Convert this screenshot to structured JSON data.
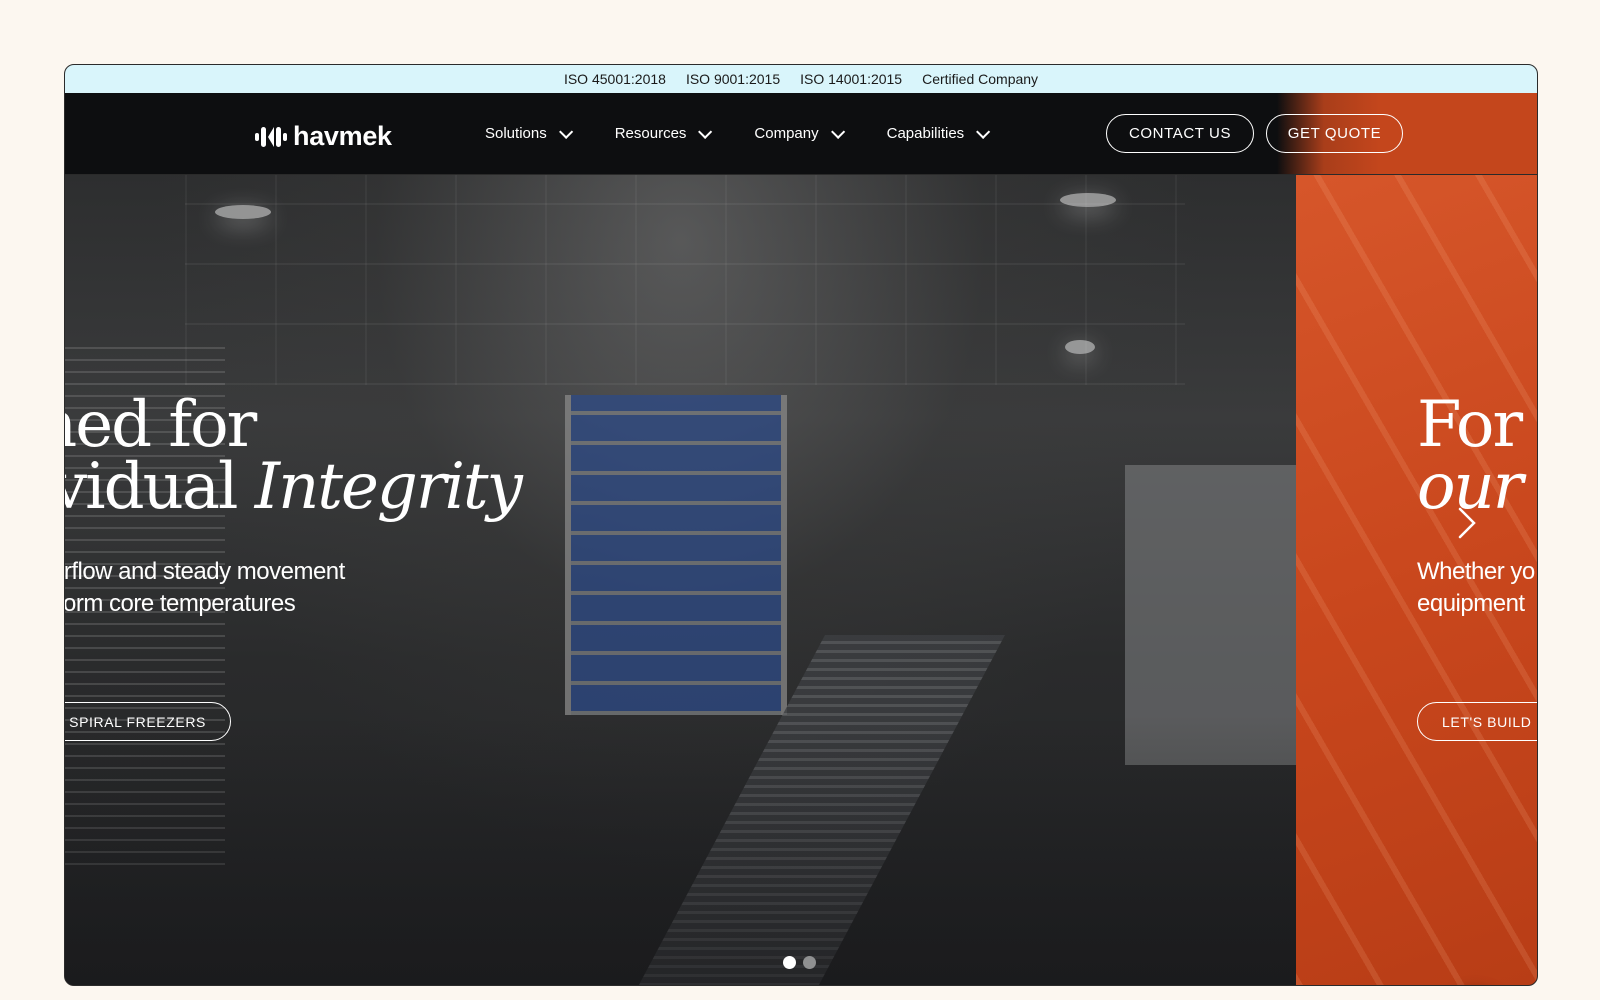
{
  "certifications": [
    "ISO 45001:2018",
    "ISO 9001:2015",
    "ISO 14001:2015",
    "Certified Company"
  ],
  "brand": {
    "name": "havmek"
  },
  "nav": [
    {
      "label": "Solutions"
    },
    {
      "label": "Resources"
    },
    {
      "label": "Company"
    },
    {
      "label": "Capabilities"
    }
  ],
  "header_buttons": {
    "contact": "CONTACT US",
    "quote": "GET QUOTE"
  },
  "slides": [
    {
      "headline_line1": "gned for",
      "headline_line2_plain": "vidual ",
      "headline_line2_italic": "Integrity",
      "sub_line1": "irflow and steady movement",
      "sub_line2": "orm core temperatures",
      "cta": "F SPIRAL FREEZERS"
    },
    {
      "headline_line1": "For y",
      "headline_line2_italic": "our e",
      "sub_line1": "Whether yo",
      "sub_line2": "equipment",
      "cta": "LET'S BUILD"
    }
  ],
  "carousel": {
    "total": 2,
    "active_index": 0
  },
  "colors": {
    "iso_bar": "#d9f5fb",
    "header": "#0d0e10",
    "accent_orange": "#c9471d",
    "whatsapp": "#25c65b",
    "page_bg": "#fcf7f0"
  },
  "icons": {
    "logo": "havmek-logo-mark",
    "next": "chevron-right-icon",
    "chat": "whatsapp-icon"
  }
}
